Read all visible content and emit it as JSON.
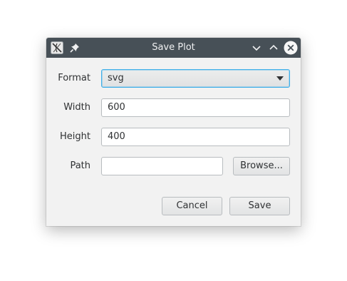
{
  "window": {
    "title": "Save Plot",
    "app_icon": "app-icon",
    "pin_icon": "pin-icon",
    "buttons": {
      "minimize_icon": "chevron-down-icon",
      "maximize_icon": "chevron-up-icon",
      "close_icon": "close-icon"
    },
    "titlebar_color": "#475057",
    "accent_color": "#3daee9"
  },
  "form": {
    "format": {
      "label": "Format",
      "value": "svg"
    },
    "width": {
      "label": "Width",
      "value": "600"
    },
    "height": {
      "label": "Height",
      "value": "400"
    },
    "path": {
      "label": "Path",
      "value": "",
      "browse_label": "Browse..."
    }
  },
  "actions": {
    "cancel_label": "Cancel",
    "save_label": "Save"
  }
}
